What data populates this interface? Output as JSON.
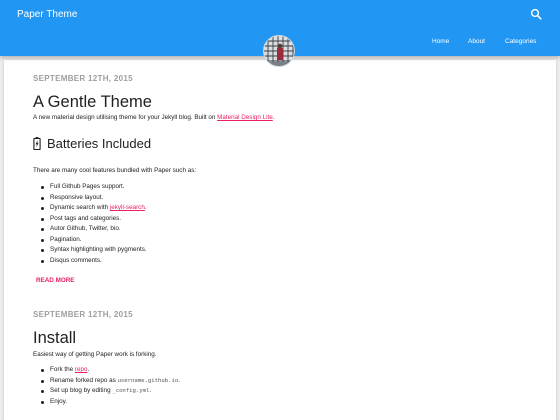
{
  "header": {
    "site_title": "Paper Theme",
    "search_icon": "search-icon",
    "accent": "#2196f3",
    "nav": [
      {
        "label": "Home"
      },
      {
        "label": "About"
      },
      {
        "label": "Categories"
      }
    ]
  },
  "avatar": {
    "icon": "avatar-photo"
  },
  "posts": [
    {
      "date": "SEPTEMBER 12TH, 2015",
      "title": "A Gentle Theme",
      "excerpt_before": "A new material design utilising theme for your Jekyll blog. Built on ",
      "excerpt_link": "Material Design Lite",
      "excerpt_after": ".",
      "subheading": "Batteries Included",
      "subheading_icon": "battery-charging-icon",
      "intro": "There are many cool features bundled with Paper such as:",
      "features": [
        {
          "text": "Full Github Pages support."
        },
        {
          "text": "Responsive layout."
        },
        {
          "before": "Dynamic search with ",
          "link": "jekyll-search",
          "after": "."
        },
        {
          "text": "Post tags and categories."
        },
        {
          "text": "Autor Github, Twitter, bio."
        },
        {
          "text": "Pagination."
        },
        {
          "text": "Syntax highlighting with pygments."
        },
        {
          "text": "Disqus comments."
        }
      ],
      "read_more": "READ MORE"
    },
    {
      "date": "SEPTEMBER 12TH, 2015",
      "title": "Install",
      "excerpt": "Easiest way of getting Paper work is forking.",
      "steps": [
        {
          "before": "Fork the ",
          "link": "repo",
          "after": "."
        },
        {
          "before": "Rename forked repo as ",
          "code": "username.github.io",
          "after": "."
        },
        {
          "before": "Set up blog by editing ",
          "code": "_config.yml",
          "after": "."
        },
        {
          "text": "Enjoy."
        }
      ]
    }
  ],
  "colors": {
    "link": "#e91e63",
    "date": "#9e9e9e",
    "text": "#212121"
  }
}
